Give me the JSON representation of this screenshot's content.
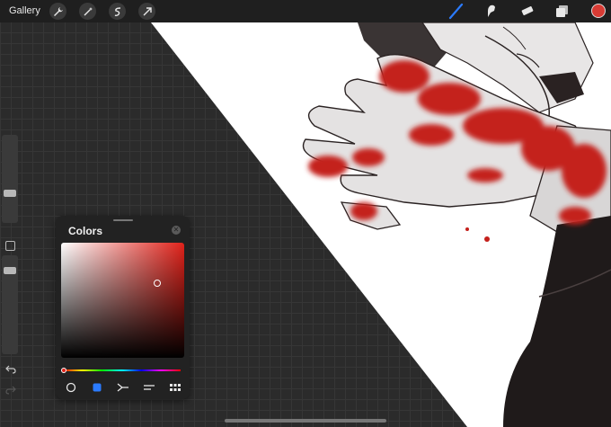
{
  "topbar": {
    "gallery_label": "Gallery",
    "left_icons": [
      "wrench-icon",
      "magic-wand-icon",
      "selection-icon",
      "transform-arrow-icon"
    ],
    "right_icons": [
      "brush-icon",
      "smudge-icon",
      "eraser-icon",
      "layers-icon"
    ],
    "current_color": "#d83b34"
  },
  "colors_panel": {
    "title": "Colors",
    "hue": "#e0221a",
    "modes": [
      "disc-mode-icon",
      "classic-mode-icon",
      "harmony-mode-icon",
      "value-mode-icon",
      "palettes-mode-icon"
    ]
  },
  "theme": {
    "accent": "#2b7bff",
    "canvas_red": "#c4201b"
  }
}
